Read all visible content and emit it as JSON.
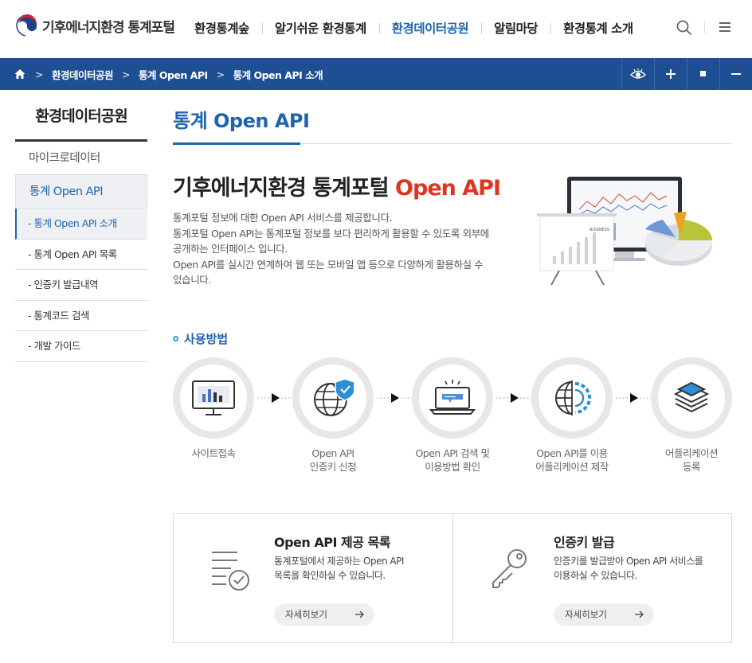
{
  "header": {
    "logo_text": "기후에너지환경 통계포털",
    "nav": [
      {
        "label": "환경통계숲"
      },
      {
        "label": "알기쉬운 환경통계"
      },
      {
        "label": "환경데이터공원"
      },
      {
        "label": "알림마당"
      },
      {
        "label": "환경통계 소개"
      }
    ],
    "active_nav_index": 2,
    "colors": {
      "brand": "#1f64ae",
      "bar": "#1e4f93",
      "accent": "#e0341f"
    }
  },
  "breadcrumb": {
    "home_icon": "home-icon",
    "items": [
      "환경데이터공원",
      "통계 Open API",
      "통계 Open API 소개"
    ],
    "tools": [
      "eye-icon",
      "plus-icon",
      "square-icon",
      "minus-icon"
    ]
  },
  "sidebar": {
    "title": "환경데이터공원",
    "items": [
      {
        "label": "마이크로데이터"
      },
      {
        "label": "통계 Open API"
      }
    ],
    "subitems": [
      {
        "label": "- 통계 Open API 소개"
      },
      {
        "label": "- 통계 Open API 목록"
      },
      {
        "label": "- 인증키 발급내역"
      },
      {
        "label": "- 통계코드 검색"
      },
      {
        "label": "- 개발 가이드"
      }
    ]
  },
  "main": {
    "page_title": "통계 Open API",
    "intro": {
      "title_main": "기후에너지환경 통계포털 ",
      "title_accent": "Open API",
      "desc": [
        "통계포털 정보에 대한 Open API 서비스를 제공합니다.",
        "통계포털 Open API는 통계포털 정보를 보다 편리하게 활용할 수 있도록 외부에",
        "공개하는 인터페이스 입니다.",
        "Open API를 실시간 연계하여 웹 또는 모바일 앱 등으로 다양하게 활용하실 수",
        "있습니다."
      ],
      "hero_board_text": "BUSINESS"
    },
    "usage": {
      "title": "사용방법",
      "steps": [
        {
          "line1": "사이트접속",
          "line2": "",
          "icon": "monitor-chart-icon"
        },
        {
          "line1": "Open API",
          "line2": "인증키 신청",
          "icon": "globe-shield-icon"
        },
        {
          "line1": "Open API 검색 및",
          "line2": "이용방법 확인",
          "icon": "laptop-search-icon"
        },
        {
          "line1": "Open API를 이용",
          "line2": "어플리케이션 제작",
          "icon": "globe-gear-icon"
        },
        {
          "line1": "어플리케이션",
          "line2": "등록",
          "icon": "layers-icon"
        }
      ]
    },
    "cards": [
      {
        "title": "Open API 제공 목록",
        "desc": [
          "통계포털에서 제공하는 Open API",
          "목록을 확인하실 수 있습니다."
        ],
        "button": "자세히보기",
        "icon": "list-check-icon"
      },
      {
        "title": "인증키 발급",
        "desc": [
          "인증키를 발급받아 Open API 서비스를",
          "이용하실 수 있습니다."
        ],
        "button": "자세히보기",
        "icon": "key-icon"
      }
    ]
  }
}
